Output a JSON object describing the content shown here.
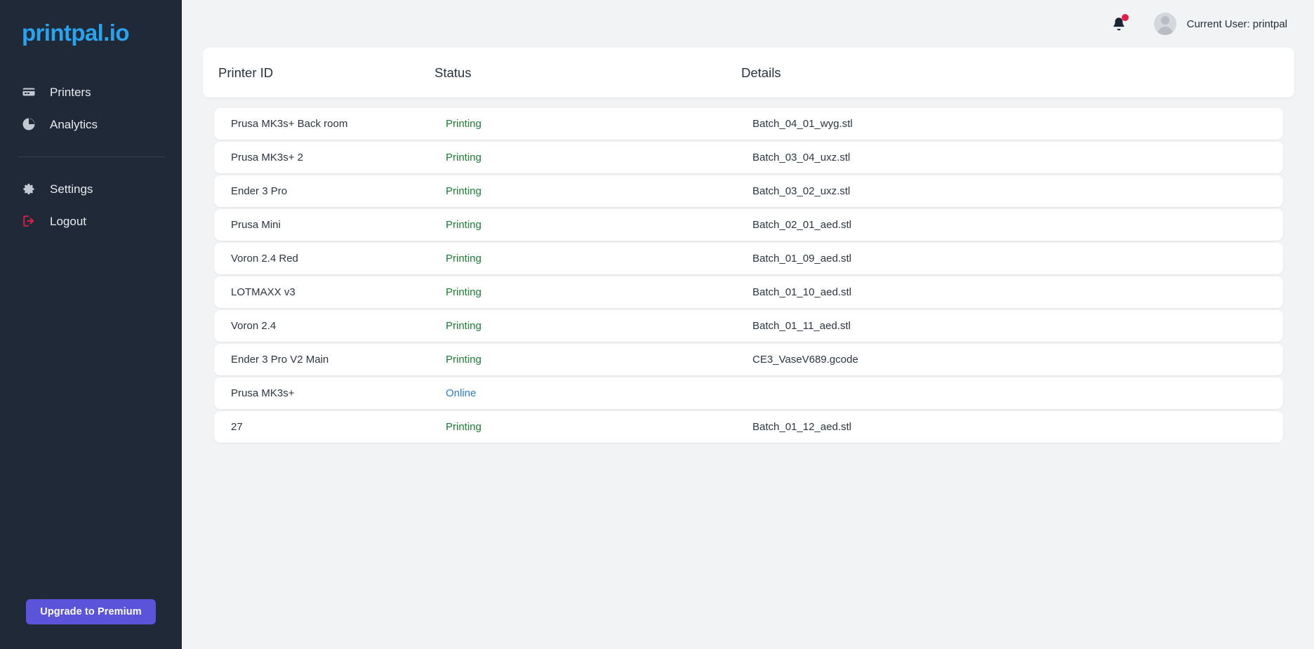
{
  "brand": {
    "logo_text": "printpal.io",
    "logo_color": "#2aa3ef"
  },
  "sidebar": {
    "nav_primary": [
      {
        "label": "Printers",
        "icon": "printer-icon"
      },
      {
        "label": "Analytics",
        "icon": "pie-chart-icon"
      }
    ],
    "nav_secondary": [
      {
        "label": "Settings",
        "icon": "gear-icon"
      },
      {
        "label": "Logout",
        "icon": "logout-icon"
      }
    ],
    "upgrade_label": "Upgrade to Premium",
    "upgrade_color": "#5b53d9",
    "background": "#1f2937"
  },
  "topbar": {
    "notification_badge": true,
    "badge_color": "#e11d48",
    "user_label": "Current User: printpal"
  },
  "table": {
    "columns": [
      "Printer ID",
      "Status",
      "Details"
    ],
    "status_colors": {
      "Printing": "#1c7c32",
      "Online": "#2b7cd3"
    },
    "rows": [
      {
        "printer": "Prusa MK3s+ Back room",
        "status": "Printing",
        "details": "Batch_04_01_wyg.stl"
      },
      {
        "printer": "Prusa MK3s+ 2",
        "status": "Printing",
        "details": "Batch_03_04_uxz.stl"
      },
      {
        "printer": "Ender 3 Pro",
        "status": "Printing",
        "details": "Batch_03_02_uxz.stl"
      },
      {
        "printer": "Prusa Mini",
        "status": "Printing",
        "details": "Batch_02_01_aed.stl"
      },
      {
        "printer": "Voron 2.4 Red",
        "status": "Printing",
        "details": "Batch_01_09_aed.stl"
      },
      {
        "printer": "LOTMAXX v3",
        "status": "Printing",
        "details": "Batch_01_10_aed.stl"
      },
      {
        "printer": "Voron 2.4",
        "status": "Printing",
        "details": "Batch_01_11_aed.stl"
      },
      {
        "printer": "Ender 3 Pro V2 Main",
        "status": "Printing",
        "details": "CE3_VaseV689.gcode"
      },
      {
        "printer": "Prusa MK3s+",
        "status": "Online",
        "details": ""
      },
      {
        "printer": "27",
        "status": "Printing",
        "details": "Batch_01_12_aed.stl"
      }
    ]
  }
}
